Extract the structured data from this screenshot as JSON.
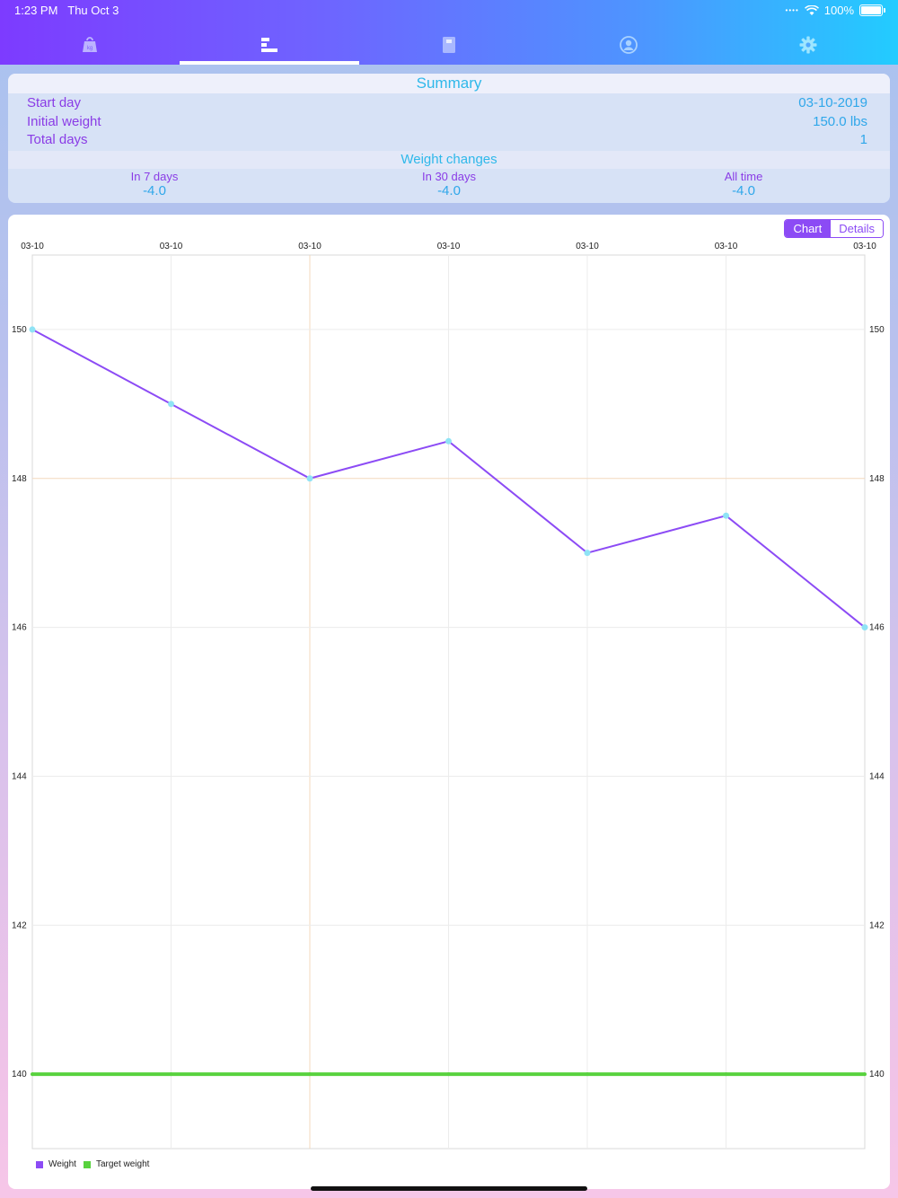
{
  "status": {
    "time": "1:23 PM",
    "date": "Thu Oct 3",
    "battery": "100%"
  },
  "tabs": [
    {
      "icon": "weight-icon",
      "active": false
    },
    {
      "icon": "chart-icon",
      "active": true
    },
    {
      "icon": "book-icon",
      "active": false
    },
    {
      "icon": "profile-icon",
      "active": false
    },
    {
      "icon": "gear-icon",
      "active": false
    }
  ],
  "summary": {
    "title": "Summary",
    "rows": [
      {
        "label": "Start day",
        "value": "03-10-2019"
      },
      {
        "label": "Initial weight",
        "value": "150.0 lbs"
      },
      {
        "label": "Total days",
        "value": "1"
      }
    ],
    "changes_title": "Weight changes",
    "changes": [
      {
        "label": "In 7 days",
        "value": "-4.0"
      },
      {
        "label": "In 30 days",
        "value": "-4.0"
      },
      {
        "label": "All time",
        "value": "-4.0"
      }
    ]
  },
  "toggle": {
    "chart": "Chart",
    "details": "Details",
    "selected": "Chart"
  },
  "colors": {
    "weight": "#8c4bf5",
    "target": "#58d23e",
    "marker": "#8fe3f5",
    "accent": "#2fa7ea"
  },
  "chart_data": {
    "type": "line",
    "x": [
      "03-10",
      "03-10",
      "03-10",
      "03-10",
      "03-10",
      "03-10",
      "03-10"
    ],
    "series": [
      {
        "name": "Weight",
        "values": [
          150,
          149,
          148,
          148.5,
          147,
          147.5,
          146
        ]
      },
      {
        "name": "Target weight",
        "values": [
          140,
          140,
          140,
          140,
          140,
          140,
          140
        ]
      }
    ],
    "ylim": [
      139,
      151
    ],
    "yticks": [
      140,
      142,
      144,
      146,
      148,
      150
    ],
    "grid": true,
    "legend": "bottom-left"
  }
}
